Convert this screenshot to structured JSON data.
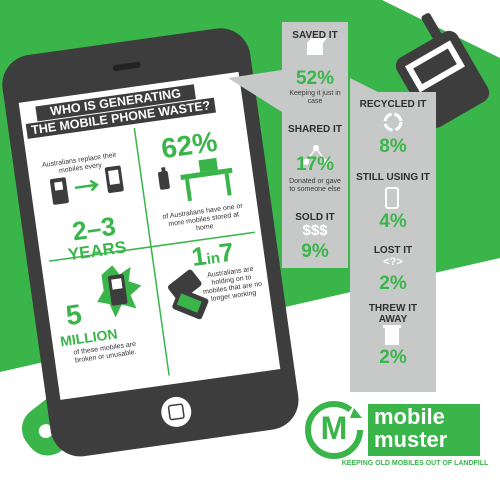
{
  "phone": {
    "title_line1": "WHO IS GENERATING",
    "title_line2": "THE MOBILE PHONE WASTE?",
    "cells": {
      "replace": {
        "text": "Australians replace their mobiles every",
        "value": "2–3",
        "unit": "YEARS"
      },
      "stored": {
        "value": "62%",
        "text": "of Australians have one or more mobiles stored at home"
      },
      "broken": {
        "value": "5",
        "unit": "MILLION",
        "text": "of these mobiles are broken or unusable."
      },
      "holding": {
        "value_main": "1",
        "value_in": "in",
        "value_end": "7",
        "text": "Australians are holding on to mobiles that are no longer working"
      }
    }
  },
  "panel_left": [
    {
      "label": "SAVED IT",
      "value": "52%",
      "desc": "Keeping it just in case",
      "icon": "box-icon"
    },
    {
      "label": "SHARED IT",
      "value": "17%",
      "desc": "Donated or gave to someone else",
      "icon": "share-icon"
    },
    {
      "label": "SOLD IT",
      "value": "9%",
      "symbol": "$$$",
      "icon": "dollar-icon"
    }
  ],
  "panel_right": [
    {
      "label": "RECYCLED IT",
      "value": "8%",
      "icon": "recycle-icon"
    },
    {
      "label": "STILL USING IT",
      "value": "4%",
      "icon": "phone-icon"
    },
    {
      "label": "LOST IT",
      "value": "2%",
      "symbol": "<?>",
      "icon": "question-icon"
    },
    {
      "label_line1": "THREW IT",
      "label_line2": "AWAY",
      "value": "2%",
      "icon": "bin-icon"
    }
  ],
  "logo": {
    "letter": "M",
    "line1": "mobile",
    "line2": "muster",
    "tagline": "KEEPING OLD MOBILES OUT OF LANDFILL"
  },
  "colors": {
    "green": "#39b54a",
    "dark": "#3d3d3d",
    "grey": "#c7c9c8"
  }
}
